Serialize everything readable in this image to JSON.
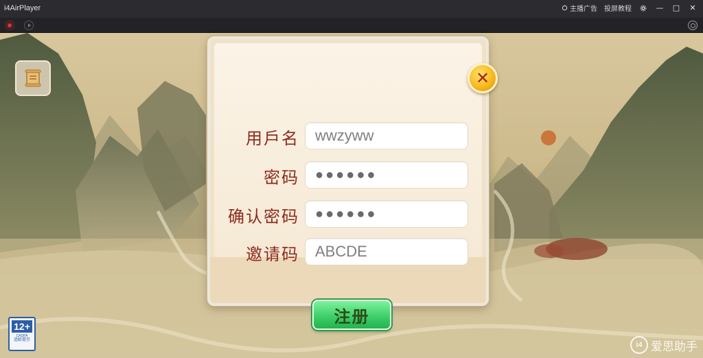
{
  "window": {
    "title": "i4AirPlayer",
    "menu_ad": "主播广告",
    "menu_tutorial": "投屏教程",
    "settings_icon": "gear-icon",
    "minimize": "—",
    "maximize": "□",
    "close": "✕"
  },
  "toolbar": {
    "record_icon": "record-icon",
    "play_icon": "play-icon",
    "target_icon": "target-icon"
  },
  "dialog": {
    "close_glyph": "✕",
    "fields": [
      {
        "label": "用戶名",
        "value": "wwzyww",
        "type": "text"
      },
      {
        "label": "密码",
        "value": "●●●●●●",
        "type": "password"
      },
      {
        "label": "确认密码",
        "value": "●●●●●●",
        "type": "password"
      },
      {
        "label": "邀请码",
        "value": "ABCDE",
        "type": "text"
      }
    ],
    "register_label": "注册"
  },
  "age_rating": {
    "value": "12+",
    "sub1": "CADPA",
    "sub2": "适龄提示"
  },
  "watermark": {
    "logo": "i4",
    "text": "爱思助手"
  },
  "colors": {
    "label": "#8e2a1e",
    "register_button": "#3fd06a",
    "close_button": "#f7b51c"
  }
}
